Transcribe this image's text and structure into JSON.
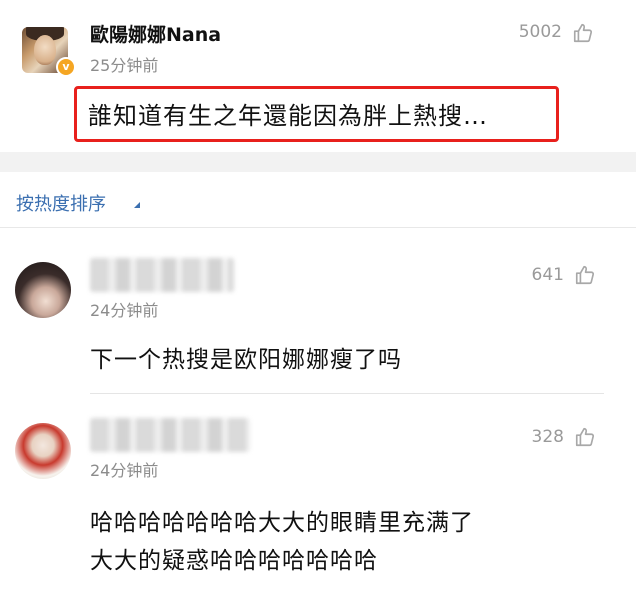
{
  "post": {
    "username": "歐陽娜娜Nana",
    "time": "25分钟前",
    "likes": "5002",
    "text": "誰知道有生之年還能因為胖上熱搜…",
    "verified_badge": "v"
  },
  "sort": {
    "label": "按热度排序"
  },
  "comments": [
    {
      "time": "24分钟前",
      "likes": "641",
      "text": "下一个热搜是欧阳娜娜瘦了吗"
    },
    {
      "time": "24分钟前",
      "likes": "328",
      "text_line1": "哈哈哈哈哈哈哈大大的眼睛里充满了",
      "text_line2": "大大的疑惑哈哈哈哈哈哈哈"
    }
  ],
  "colors": {
    "highlight_border": "#e8201c",
    "link": "#3b6fb0",
    "badge": "#f5a623"
  },
  "icons": {
    "like": "thumbs-up-icon",
    "sort": "caret-icon"
  }
}
